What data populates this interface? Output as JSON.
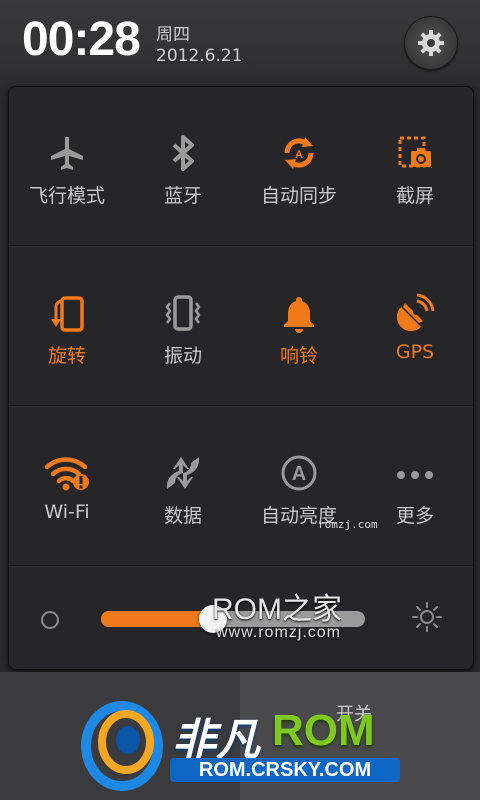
{
  "status": {
    "time": "00:28",
    "weekday": "周四",
    "date": "2012.6.21"
  },
  "toggles": [
    {
      "label": "飞行模式",
      "icon": "airplane-icon",
      "on": false
    },
    {
      "label": "蓝牙",
      "icon": "bluetooth-icon",
      "on": false
    },
    {
      "label": "自动同步",
      "icon": "sync-icon",
      "on": true
    },
    {
      "label": "截屏",
      "icon": "screenshot-icon",
      "on": false
    },
    {
      "label": "旋转",
      "icon": "rotate-icon",
      "on": true
    },
    {
      "label": "振动",
      "icon": "vibrate-icon",
      "on": false
    },
    {
      "label": "响铃",
      "icon": "bell-icon",
      "on": true
    },
    {
      "label": "GPS",
      "icon": "gps-icon",
      "on": true
    },
    {
      "label": "Wi-Fi",
      "icon": "wifi-icon",
      "on": true
    },
    {
      "label": "数据",
      "icon": "data-icon",
      "on": false
    },
    {
      "label": "自动亮度",
      "icon": "auto-brightness-icon",
      "on": false
    },
    {
      "label": "更多",
      "icon": "more-icon",
      "on": false
    }
  ],
  "brightness": {
    "level": 0.37
  },
  "watermarks": {
    "romzj_big": "ROM之家",
    "romzj_url": "www.romzj.com",
    "romzj_small": "romzj.com"
  },
  "bottom": {
    "partial_text": "开关"
  },
  "logo": {
    "name": "非凡",
    "rom": "ROM",
    "url": "ROM.CRSKY.COM"
  },
  "colors": {
    "accent": "#f07a1a",
    "inactive": "#c8c8c8",
    "panel": "#262628"
  }
}
